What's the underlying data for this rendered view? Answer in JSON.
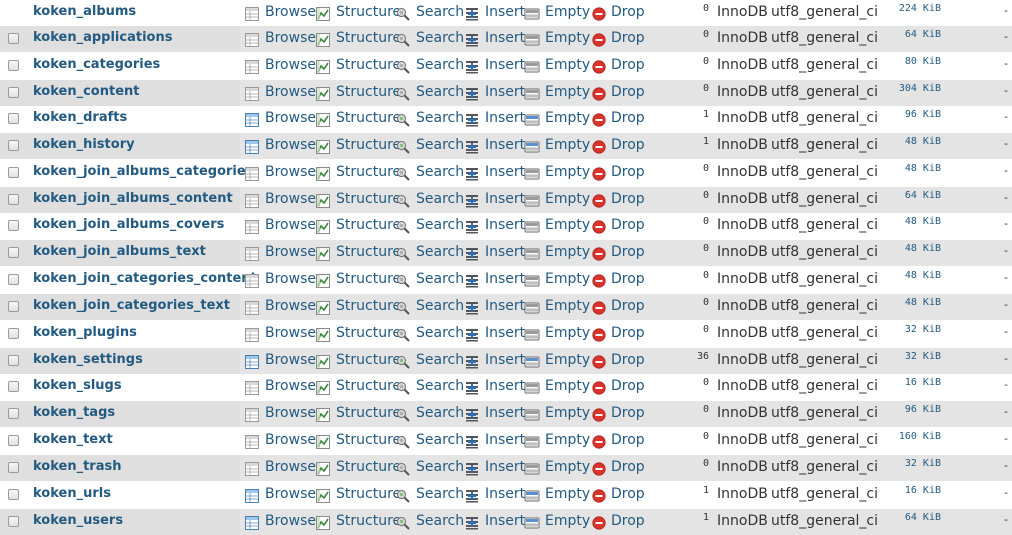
{
  "actions": {
    "browse": "Browse",
    "structure": "Structure",
    "search": "Search",
    "insert": "Insert",
    "empty": "Empty",
    "drop": "Drop"
  },
  "overhead_placeholder": "-",
  "tables": [
    {
      "name": "koken_albums",
      "rows": "0",
      "engine": "InnoDB",
      "collation": "utf8_general_ci",
      "size": "224 KiB",
      "has_rows": false
    },
    {
      "name": "koken_applications",
      "rows": "0",
      "engine": "InnoDB",
      "collation": "utf8_general_ci",
      "size": "64 KiB",
      "has_rows": false
    },
    {
      "name": "koken_categories",
      "rows": "0",
      "engine": "InnoDB",
      "collation": "utf8_general_ci",
      "size": "80 KiB",
      "has_rows": false
    },
    {
      "name": "koken_content",
      "rows": "0",
      "engine": "InnoDB",
      "collation": "utf8_general_ci",
      "size": "304 KiB",
      "has_rows": false
    },
    {
      "name": "koken_drafts",
      "rows": "1",
      "engine": "InnoDB",
      "collation": "utf8_general_ci",
      "size": "96 KiB",
      "has_rows": true
    },
    {
      "name": "koken_history",
      "rows": "1",
      "engine": "InnoDB",
      "collation": "utf8_general_ci",
      "size": "48 KiB",
      "has_rows": true
    },
    {
      "name": "koken_join_albums_categories",
      "rows": "0",
      "engine": "InnoDB",
      "collation": "utf8_general_ci",
      "size": "48 KiB",
      "has_rows": false
    },
    {
      "name": "koken_join_albums_content",
      "rows": "0",
      "engine": "InnoDB",
      "collation": "utf8_general_ci",
      "size": "64 KiB",
      "has_rows": false
    },
    {
      "name": "koken_join_albums_covers",
      "rows": "0",
      "engine": "InnoDB",
      "collation": "utf8_general_ci",
      "size": "48 KiB",
      "has_rows": false
    },
    {
      "name": "koken_join_albums_text",
      "rows": "0",
      "engine": "InnoDB",
      "collation": "utf8_general_ci",
      "size": "48 KiB",
      "has_rows": false
    },
    {
      "name": "koken_join_categories_content",
      "rows": "0",
      "engine": "InnoDB",
      "collation": "utf8_general_ci",
      "size": "48 KiB",
      "has_rows": false
    },
    {
      "name": "koken_join_categories_text",
      "rows": "0",
      "engine": "InnoDB",
      "collation": "utf8_general_ci",
      "size": "48 KiB",
      "has_rows": false
    },
    {
      "name": "koken_plugins",
      "rows": "0",
      "engine": "InnoDB",
      "collation": "utf8_general_ci",
      "size": "32 KiB",
      "has_rows": false
    },
    {
      "name": "koken_settings",
      "rows": "36",
      "engine": "InnoDB",
      "collation": "utf8_general_ci",
      "size": "32 KiB",
      "has_rows": true
    },
    {
      "name": "koken_slugs",
      "rows": "0",
      "engine": "InnoDB",
      "collation": "utf8_general_ci",
      "size": "16 KiB",
      "has_rows": false
    },
    {
      "name": "koken_tags",
      "rows": "0",
      "engine": "InnoDB",
      "collation": "utf8_general_ci",
      "size": "96 KiB",
      "has_rows": false
    },
    {
      "name": "koken_text",
      "rows": "0",
      "engine": "InnoDB",
      "collation": "utf8_general_ci",
      "size": "160 KiB",
      "has_rows": false
    },
    {
      "name": "koken_trash",
      "rows": "0",
      "engine": "InnoDB",
      "collation": "utf8_general_ci",
      "size": "32 KiB",
      "has_rows": false
    },
    {
      "name": "koken_urls",
      "rows": "1",
      "engine": "InnoDB",
      "collation": "utf8_general_ci",
      "size": "16 KiB",
      "has_rows": true
    },
    {
      "name": "koken_users",
      "rows": "1",
      "engine": "InnoDB",
      "collation": "utf8_general_ci",
      "size": "64 KiB",
      "has_rows": true
    }
  ],
  "icons": {
    "browse": "table-icon",
    "structure": "structure-icon",
    "search": "magnifier-icon",
    "insert": "insert-row-icon",
    "empty": "empty-table-icon",
    "drop": "drop-icon"
  },
  "colors": {
    "link": "#235a81",
    "row_odd": "#e4e4e4",
    "drop_red": "#d9332b"
  }
}
